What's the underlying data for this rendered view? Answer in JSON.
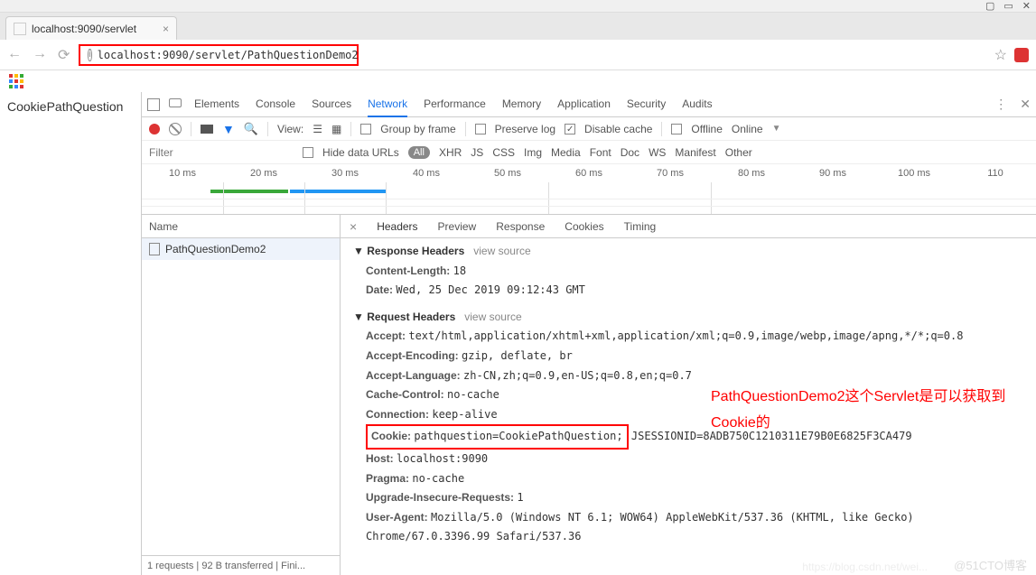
{
  "window_controls": [
    "▢",
    "▭",
    "✕"
  ],
  "browser_tab": {
    "title": "localhost:9090/servlet",
    "close": "×"
  },
  "nav": {
    "back": "←",
    "forward": "→",
    "reload": "⟳"
  },
  "url": {
    "info": "i",
    "text": "localhost:9090/servlet/PathQuestionDemo2",
    "star": "☆"
  },
  "page_body": "CookiePathQuestion",
  "devtools": {
    "tabs": [
      "Elements",
      "Console",
      "Sources",
      "Network",
      "Performance",
      "Memory",
      "Application",
      "Security",
      "Audits"
    ],
    "active_tab": "Network",
    "menu": "⋮",
    "close": "✕",
    "toolbar": {
      "view_label": "View:",
      "group_by_frame": "Group by frame",
      "preserve_log": "Preserve log",
      "disable_cache": "Disable cache",
      "offline": "Offline",
      "online": "Online",
      "dropdown": "▼"
    },
    "filter": {
      "placeholder": "Filter",
      "hide_data_urls": "Hide data URLs",
      "all": "All",
      "types": [
        "XHR",
        "JS",
        "CSS",
        "Img",
        "Media",
        "Font",
        "Doc",
        "WS",
        "Manifest",
        "Other"
      ]
    },
    "timeline_ticks": [
      "10 ms",
      "20 ms",
      "30 ms",
      "40 ms",
      "50 ms",
      "60 ms",
      "70 ms",
      "80 ms",
      "90 ms",
      "100 ms",
      "110"
    ],
    "requests": {
      "name_header": "Name",
      "items": [
        "PathQuestionDemo2"
      ],
      "status": "1 requests | 92 B transferred | Fini..."
    },
    "detail_tabs": {
      "close": "×",
      "items": [
        "Headers",
        "Preview",
        "Response",
        "Cookies",
        "Timing"
      ]
    },
    "headers": {
      "response_headers_label": "Response Headers",
      "view_source": "view source",
      "content_length_k": "Content-Length:",
      "content_length_v": "18",
      "date_k": "Date:",
      "date_v": "Wed, 25 Dec 2019 09:12:43 GMT",
      "request_headers_label": "Request Headers",
      "accept_k": "Accept:",
      "accept_v": "text/html,application/xhtml+xml,application/xml;q=0.9,image/webp,image/apng,*/*;q=0.8",
      "accept_encoding_k": "Accept-Encoding:",
      "accept_encoding_v": "gzip, deflate, br",
      "accept_language_k": "Accept-Language:",
      "accept_language_v": "zh-CN,zh;q=0.9,en-US;q=0.8,en;q=0.7",
      "cache_control_k": "Cache-Control:",
      "cache_control_v": "no-cache",
      "connection_k": "Connection:",
      "connection_v": "keep-alive",
      "cookie_k": "Cookie:",
      "cookie_v1": "pathquestion=CookiePathQuestion;",
      "cookie_v2": "JSESSIONID=8ADB750C1210311E79B0E6825F3CA479",
      "host_k": "Host:",
      "host_v": "localhost:9090",
      "pragma_k": "Pragma:",
      "pragma_v": "no-cache",
      "uir_k": "Upgrade-Insecure-Requests:",
      "uir_v": "1",
      "ua_k": "User-Agent:",
      "ua_v": "Mozilla/5.0 (Windows NT 6.1; WOW64) AppleWebKit/537.36 (KHTML, like Gecko) Chrome/67.0.3396.99 Safari/537.36"
    }
  },
  "annotation": "PathQuestionDemo2这个Servlet是可以获取到Cookie的",
  "watermark1": "@51CTO博客",
  "watermark2": "https://blog.csdn.net/wei..."
}
